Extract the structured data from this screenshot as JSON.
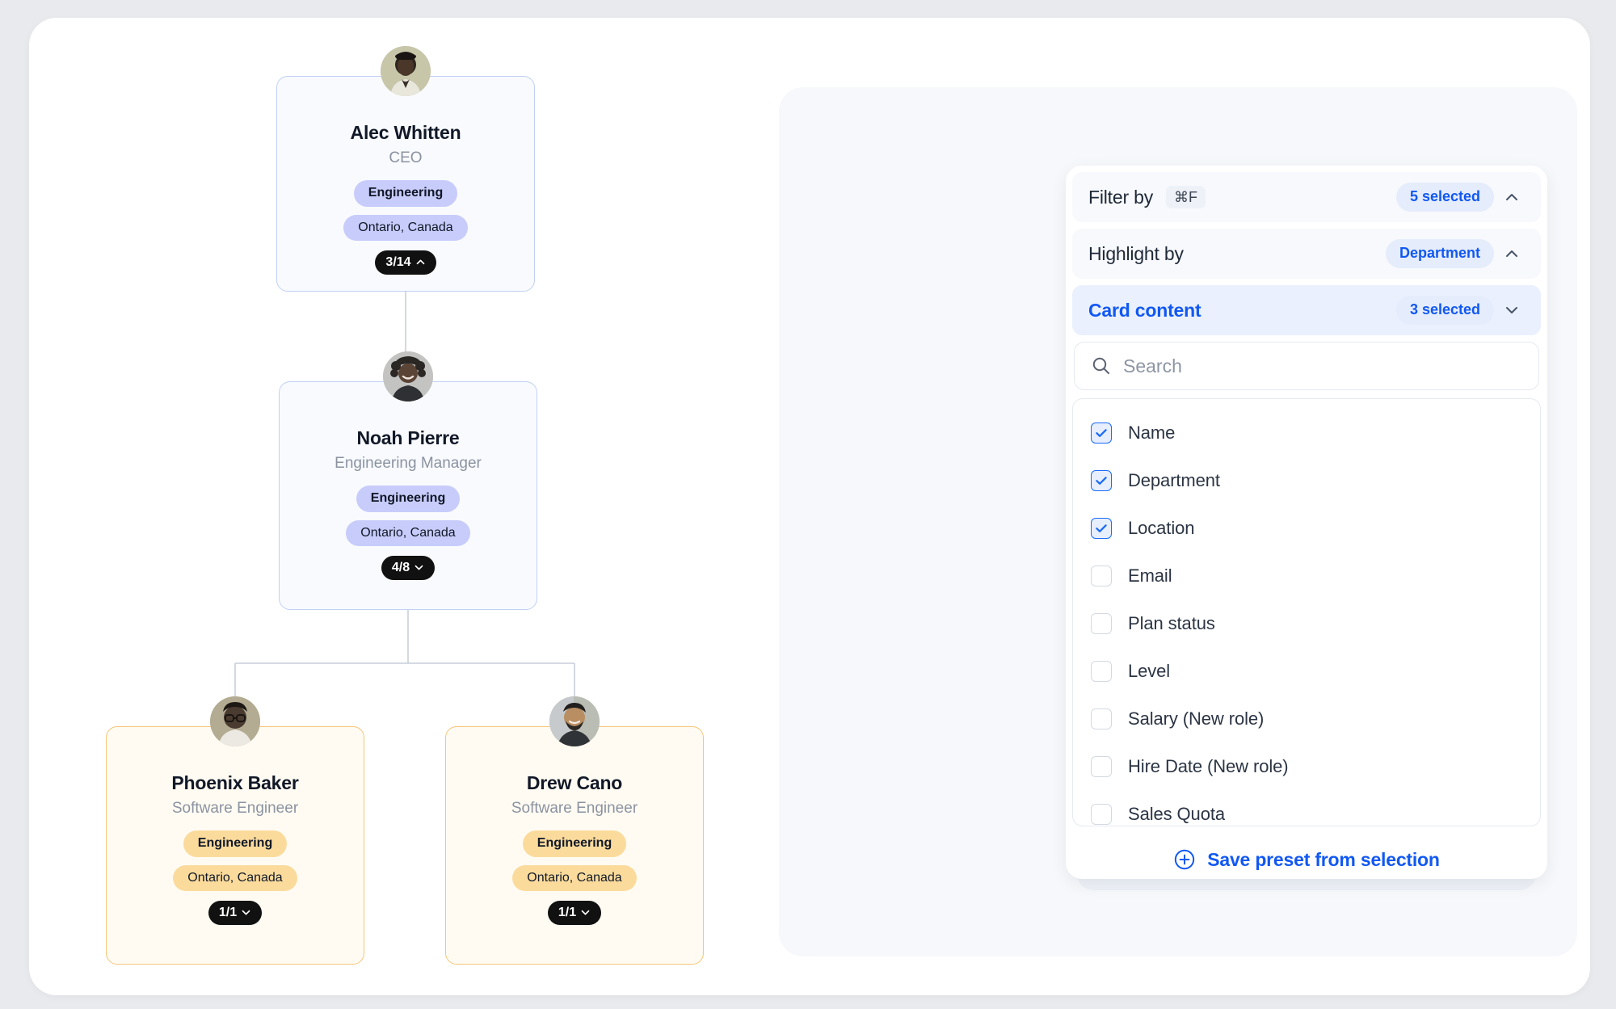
{
  "org_chart": {
    "nodes": [
      {
        "id": "alec",
        "name": "Alec Whitten",
        "title": "CEO",
        "department": "Engineering",
        "location": "Ontario, Canada",
        "count": "3/14",
        "chevron": "chevron-up",
        "theme": "blue"
      },
      {
        "id": "noah",
        "name": "Noah Pierre",
        "title": "Engineering Manager",
        "department": "Engineering",
        "location": "Ontario, Canada",
        "count": "4/8",
        "chevron": "chevron-down",
        "theme": "blue"
      },
      {
        "id": "phoenix",
        "name": "Phoenix Baker",
        "title": "Software Engineer",
        "department": "Engineering",
        "location": "Ontario, Canada",
        "count": "1/1",
        "chevron": "chevron-down",
        "theme": "amber"
      },
      {
        "id": "drew",
        "name": "Drew Cano",
        "title": "Software Engineer",
        "department": "Engineering",
        "location": "Ontario, Canada",
        "count": "1/1",
        "chevron": "chevron-down",
        "theme": "amber"
      }
    ]
  },
  "panel": {
    "rows": [
      {
        "label": "Filter by",
        "kbd": "⌘F",
        "chip": "5 selected",
        "chevron": "chevron-up",
        "active": false
      },
      {
        "label": "Highlight by",
        "kbd": "",
        "chip": "Department",
        "chevron": "chevron-up",
        "active": false
      },
      {
        "label": "Card content",
        "kbd": "",
        "chip": "3 selected",
        "chevron": "chevron-down",
        "active": true
      }
    ],
    "search": {
      "placeholder": "Search",
      "value": "",
      "icon": "search-icon"
    },
    "options": [
      {
        "label": "Name",
        "checked": true
      },
      {
        "label": "Department",
        "checked": true
      },
      {
        "label": "Location",
        "checked": true
      },
      {
        "label": "Email",
        "checked": false
      },
      {
        "label": "Plan status",
        "checked": false
      },
      {
        "label": "Level",
        "checked": false
      },
      {
        "label": "Salary (New role)",
        "checked": false
      },
      {
        "label": "Hire Date (New role)",
        "checked": false
      },
      {
        "label": "Sales Quota",
        "checked": false
      }
    ],
    "save_preset": {
      "label": "Save preset from selection",
      "icon": "plus-circle-icon"
    }
  },
  "colors": {
    "accent_blue": "#1158f2",
    "pill_blue": "#c7ccfb",
    "pill_amber": "#fbdb9c",
    "card_border_blue": "#c2d0f5",
    "card_border_amber": "#f4c67a",
    "badge_black": "#111111"
  }
}
